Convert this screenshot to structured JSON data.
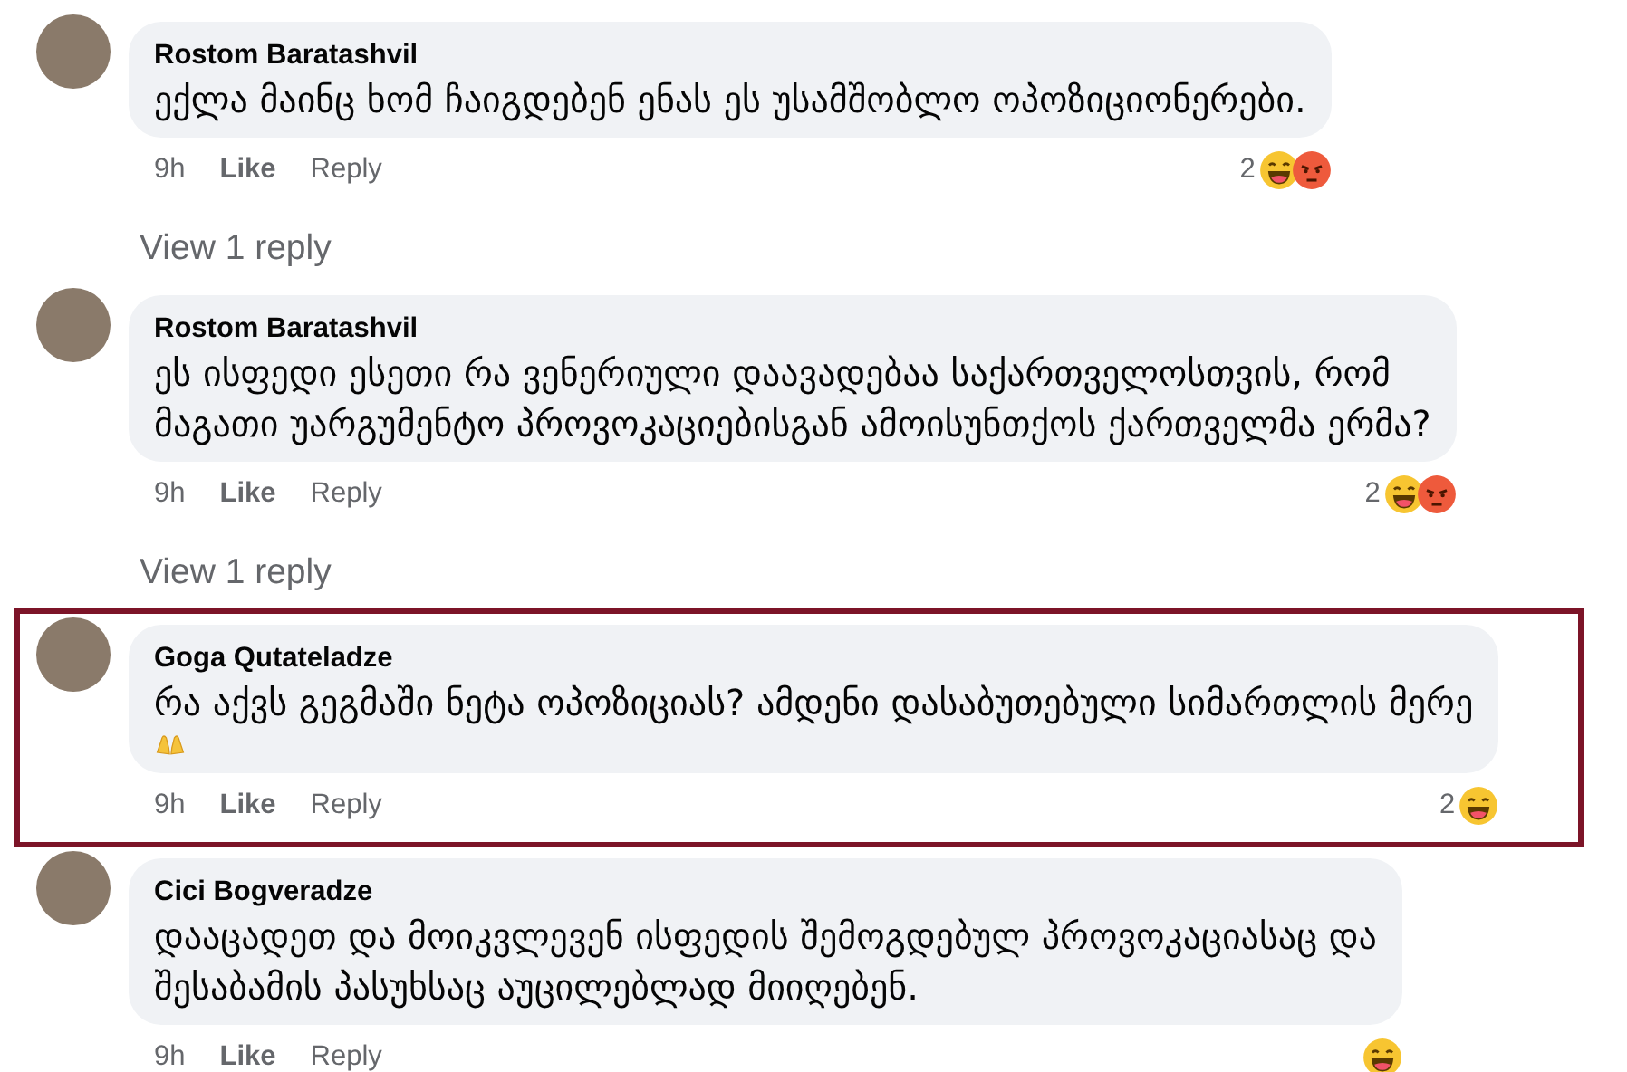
{
  "comments": [
    {
      "author": "Rostom Baratashvil",
      "lines": [
        "ექლა მაინც ხომ ჩაიგდებენ ენას ეს უსამშობლო ოპოზიციონერები."
      ],
      "emoji_end": false,
      "time": "9h",
      "like": "Like",
      "reply": "Reply",
      "reaction_count": "2",
      "reactions": [
        {
          "kind": "haha"
        },
        {
          "kind": "angry"
        }
      ],
      "highlighted": false,
      "view_replies": "View 1 reply"
    },
    {
      "author": "Rostom Baratashvil",
      "lines": [
        "ეს ისფედი ესეთი რა ვენერიული დაავადებაა საქართველოსთვის, რომ",
        "მაგათი უარგუმენტო პროვოკაციებისგან ამოისუნთქოს ქართველმა ერმა?"
      ],
      "emoji_end": false,
      "time": "9h",
      "like": "Like",
      "reply": "Reply",
      "reaction_count": "2",
      "reactions": [
        {
          "kind": "haha"
        },
        {
          "kind": "angry"
        }
      ],
      "highlighted": false,
      "view_replies": "View 1 reply"
    },
    {
      "author": "Goga Qutateladze",
      "lines": [
        "რა აქვს გეგმაში ნეტა ოპოზიციას? ამდენი დასაბუთებული სიმართლის მერე"
      ],
      "emoji_end": true,
      "time": "9h",
      "like": "Like",
      "reply": "Reply",
      "reaction_count": "2",
      "reactions": [
        {
          "kind": "haha"
        }
      ],
      "highlighted": true
    },
    {
      "author": "Cici Bogveradze",
      "lines": [
        "დააცადეთ და მოიკვლევენ ისფედის შემოგდებულ პროვოკაციასაც და",
        "შესაბამის პასუხსაც აუცილებლად მიიღებენ."
      ],
      "emoji_end": false,
      "time": "9h",
      "like": "Like",
      "reply": "Reply",
      "reactions": [
        {
          "kind": "haha"
        }
      ],
      "highlighted": false
    }
  ]
}
